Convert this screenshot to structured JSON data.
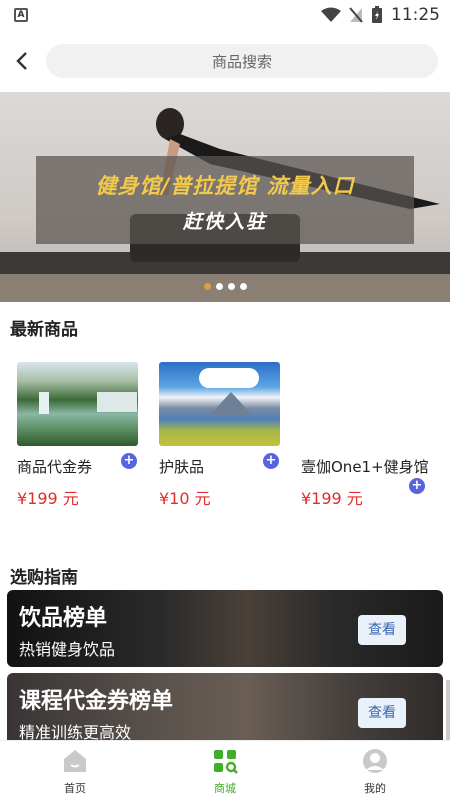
{
  "status_bar": {
    "time": "11:25"
  },
  "header": {
    "search_placeholder": "商品搜索"
  },
  "banner": {
    "headline": "健身馆/普拉提馆 流量入口",
    "subline": "赶快入驻"
  },
  "latest": {
    "title": "最新商品",
    "products": [
      {
        "name": "商品代金券",
        "price": "¥199 元"
      },
      {
        "name": "护肤品",
        "price": "¥10 元"
      },
      {
        "name": "壹伽One1+健身馆",
        "price": "¥199 元"
      }
    ]
  },
  "guide": {
    "title": "选购指南",
    "cards": [
      {
        "title": "饮品榜单",
        "subtitle": "热销健身饮品",
        "button": "查看"
      },
      {
        "title": "课程代金券榜单",
        "subtitle": "精准训练更高效",
        "button": "查看"
      }
    ]
  },
  "tabbar": {
    "items": [
      {
        "label": "首页",
        "icon": "home-icon"
      },
      {
        "label": "商城",
        "icon": "mall-icon"
      },
      {
        "label": "我的",
        "icon": "profile-icon"
      }
    ],
    "active_color": "#3fae2a"
  },
  "colors": {
    "price": "#e02d2d",
    "plus": "#5664e0",
    "banner_headline": "#f3c94c"
  }
}
